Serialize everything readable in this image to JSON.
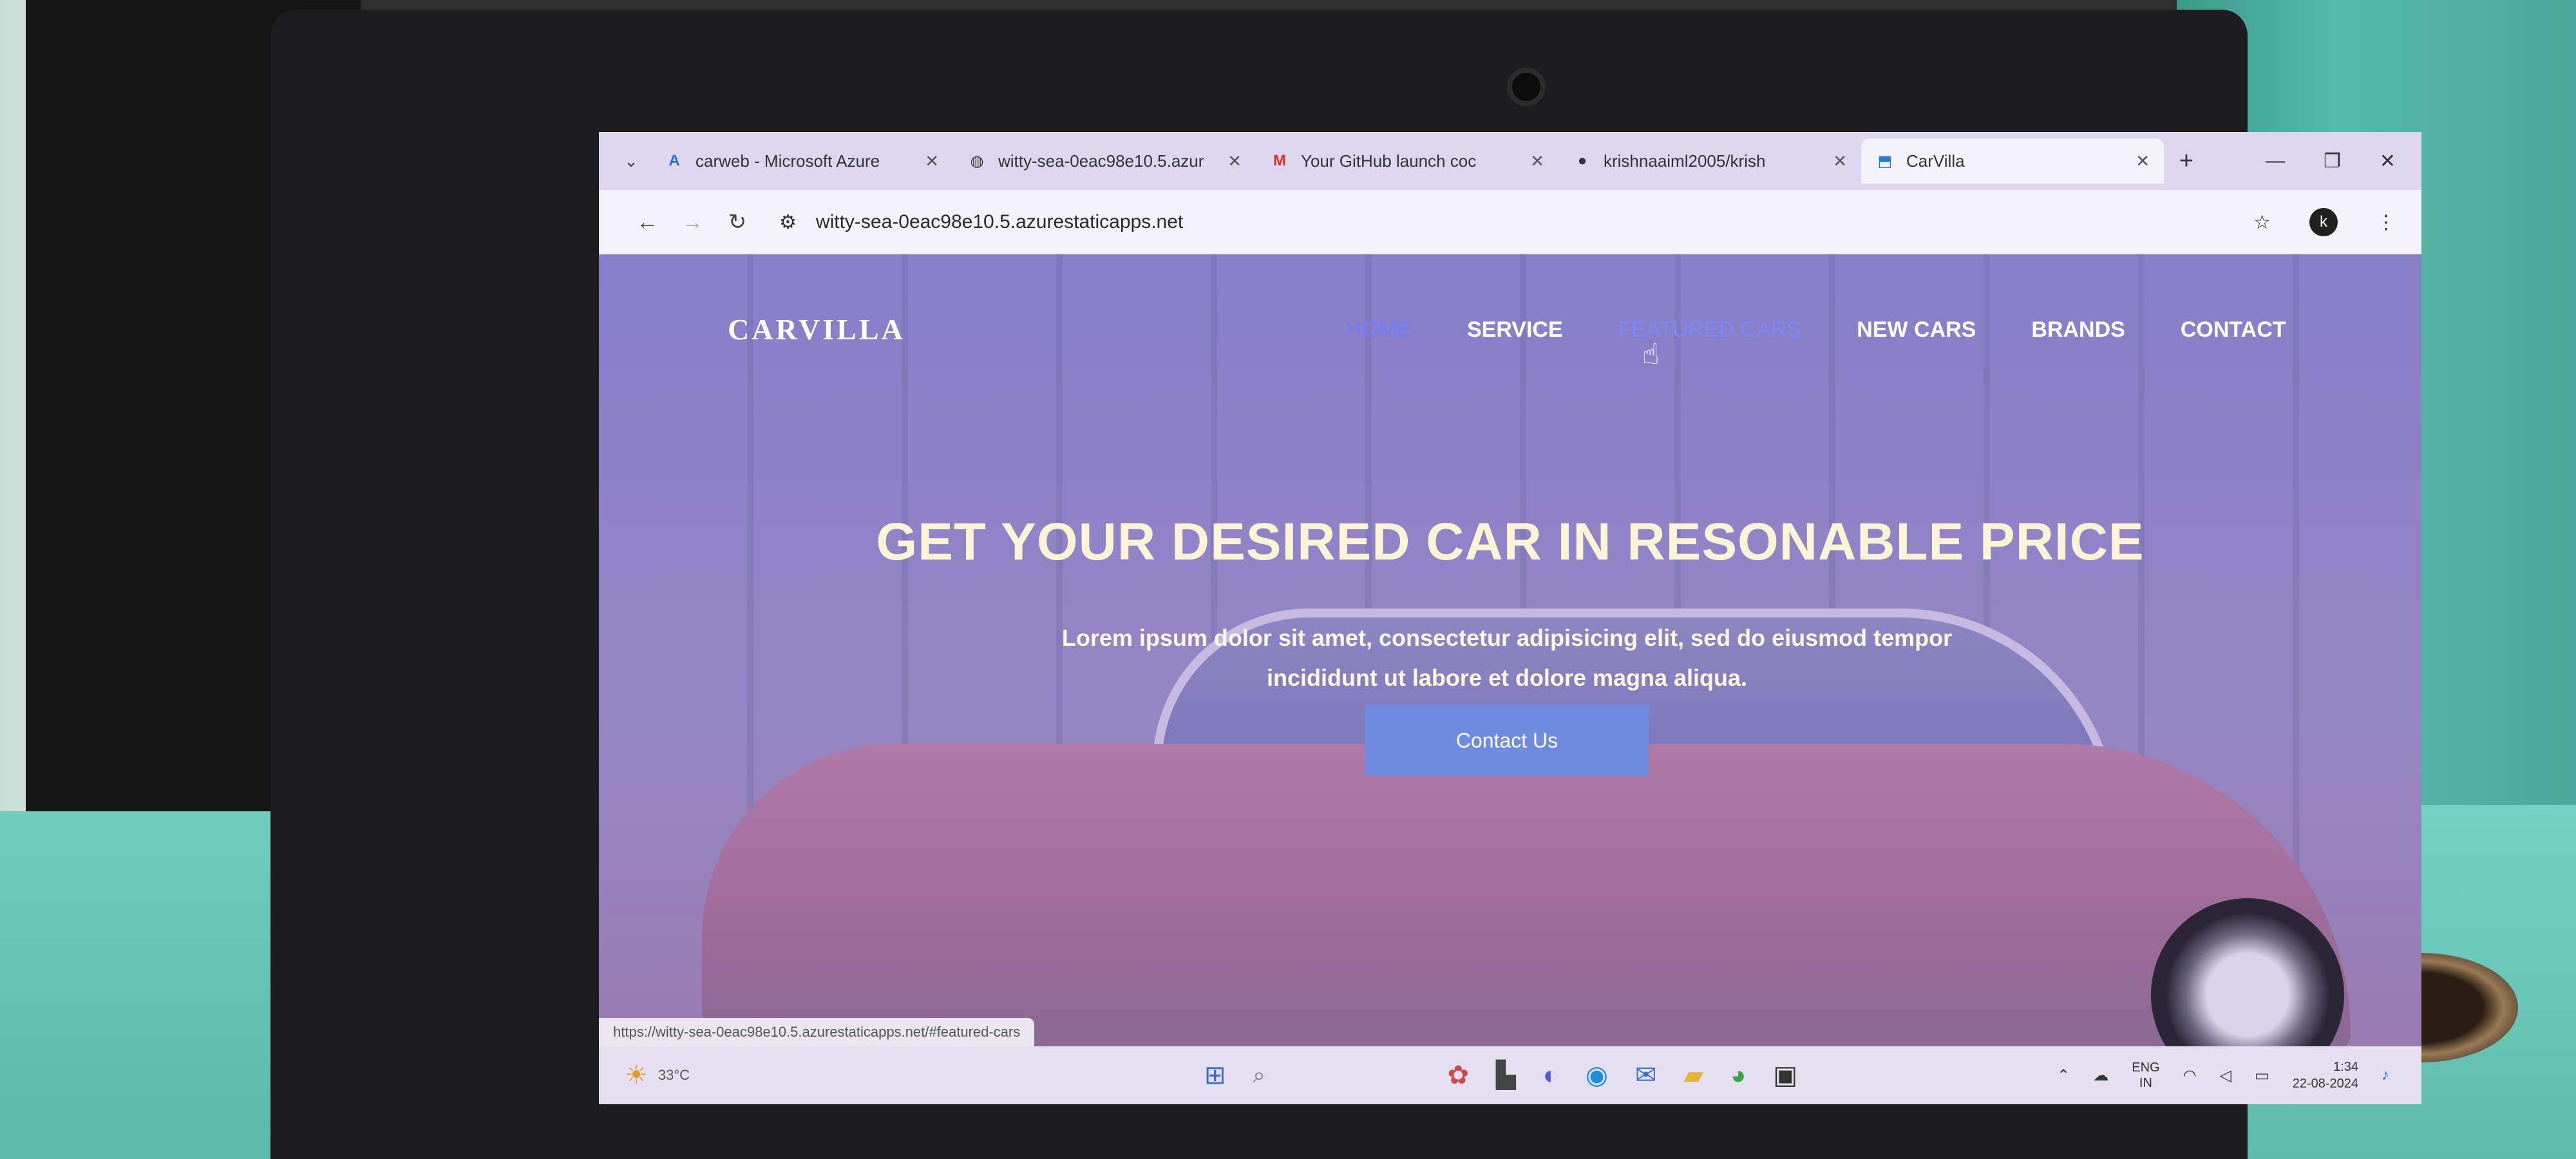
{
  "browser": {
    "tabs": [
      {
        "title": "carweb - Microsoft Azure",
        "icon": "azure-icon",
        "active": false
      },
      {
        "title": "witty-sea-0eac98e10.5.azur",
        "icon": "globe-icon",
        "active": false
      },
      {
        "title": "Your GitHub launch coc",
        "icon": "gmail-icon",
        "active": false
      },
      {
        "title": "krishnaaiml2005/krish",
        "icon": "github-icon",
        "active": false
      },
      {
        "title": "CarVilla",
        "icon": "carvilla-icon",
        "active": true
      }
    ],
    "new_tab_label": "+",
    "url": "witty-sea-0eac98e10.5.azurestaticapps.net",
    "profile_initial": "k",
    "status_url": "https://witty-sea-0eac98e10.5.azurestaticapps.net/#featured-cars"
  },
  "site": {
    "brand": "CARVILLA",
    "nav": [
      "HOME",
      "SERVICE",
      "FEATURED CARS",
      "NEW CARS",
      "BRANDS",
      "CONTACT"
    ],
    "hero_title": "GET YOUR DESIRED CAR IN RESONABLE PRICE",
    "hero_text_line1": "Lorem ipsum dolor sit amet, consectetur adipisicing elit, sed do eiusmod tempor",
    "hero_text_line2": "incididunt ut labore et dolore magna aliqua.",
    "cta_label": "Contact Us"
  },
  "taskbar": {
    "temperature": "33°C",
    "language_line1": "ENG",
    "language_line2": "IN",
    "time": "1:34",
    "date": "22-08-2024"
  },
  "colors": {
    "nav_active": "#6e7cff",
    "cta_background": "#6f8be0",
    "hero_title": "#fdf4d8"
  }
}
